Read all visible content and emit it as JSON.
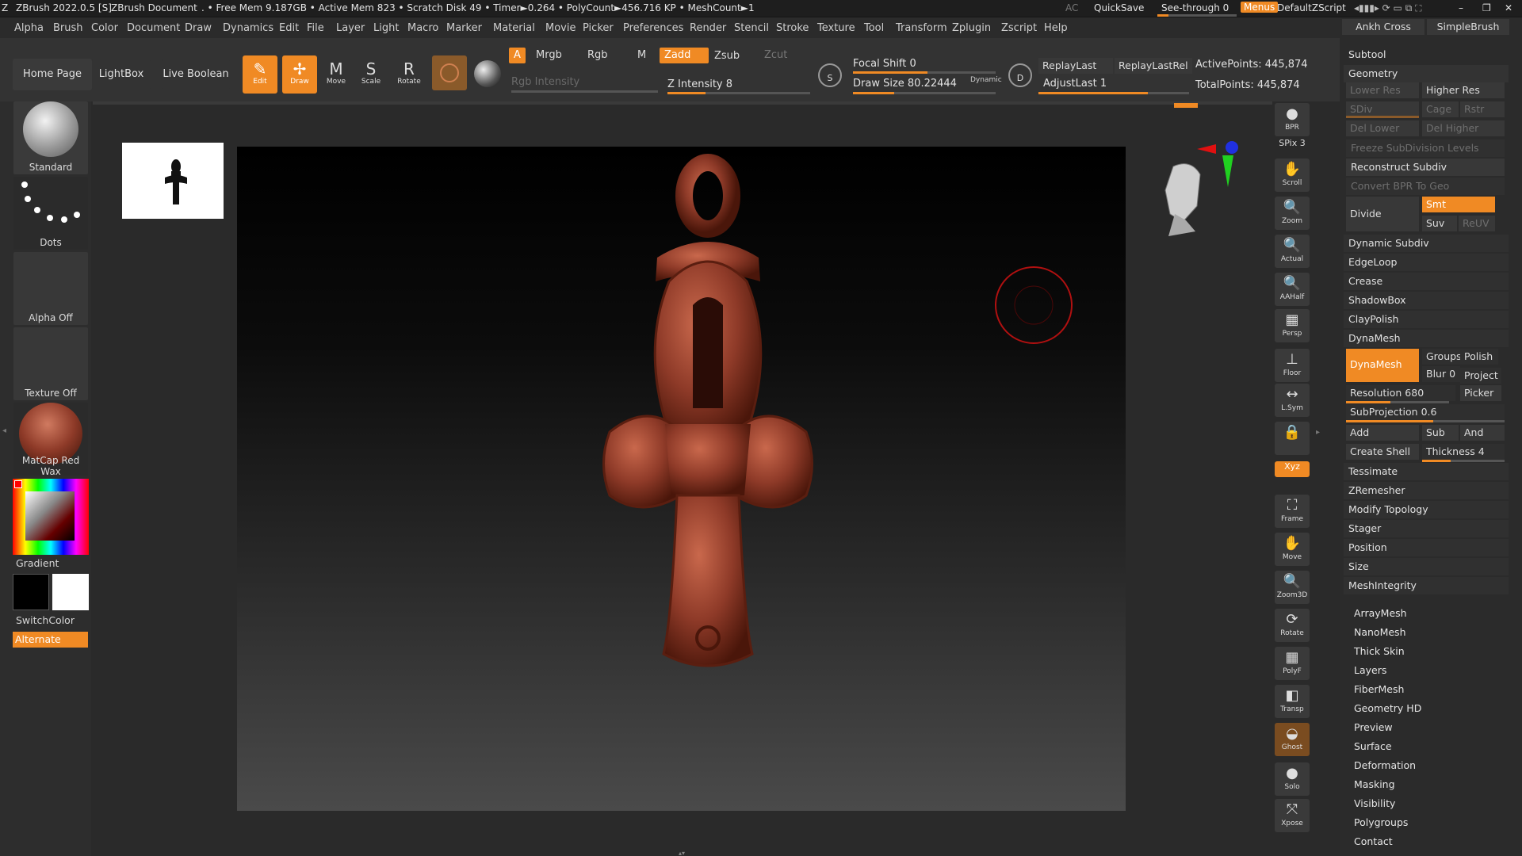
{
  "titlebar": {
    "app": "ZBrush 2022.0.5 [S]",
    "document": "ZBrush Document",
    "stats": ". • Free Mem 9.187GB • Active Mem 823 • Scratch Disk 49 • Timer►0.264 • PolyCount►456.716 KP • MeshCount►1",
    "ac": "AC",
    "quicksave": "QuickSave",
    "seethrough": "See-through  0",
    "menus": "Menus",
    "script": "DefaultZScript"
  },
  "menubar": [
    "Alpha",
    "Brush",
    "Color",
    "Document",
    "Draw",
    "Dynamics",
    "Edit",
    "File",
    "Layer",
    "Light",
    "Macro",
    "Marker",
    "Material",
    "Movie",
    "Picker",
    "Preferences",
    "Render",
    "Stencil",
    "Stroke",
    "Texture",
    "Tool",
    "Transform",
    "Zplugin",
    "Zscript",
    "Help"
  ],
  "toolbar": {
    "home": "Home Page",
    "lightbox": "LightBox",
    "liveboolean": "Live Boolean",
    "tools": [
      {
        "label": "Edit",
        "icon": "✎",
        "on": true
      },
      {
        "label": "Draw",
        "icon": "✢",
        "on": true
      },
      {
        "label": "Move",
        "icon": "M",
        "on": false
      },
      {
        "label": "Scale",
        "icon": "S",
        "on": false
      },
      {
        "label": "Rotate",
        "icon": "R",
        "on": false
      }
    ],
    "a": "A",
    "mrgb": "Mrgb",
    "rgb": "Rgb",
    "m": "M",
    "zadd": "Zadd",
    "zsub": "Zsub",
    "zcut": "Zcut",
    "rgb_intensity": "Rgb Intensity",
    "z_intensity": "Z Intensity 8",
    "focal_shift": "Focal Shift 0",
    "draw_size": "Draw Size 80.22444",
    "dynamic": "Dynamic",
    "replaylast": "ReplayLast",
    "replaylastrel": "ReplayLastRel",
    "adjustlast": "AdjustLast 1",
    "activepoints": "ActivePoints: 445,874",
    "totalpoints": "TotalPoints: 445,874",
    "s_label": "S",
    "d_label": "D"
  },
  "leftshelf": {
    "brush": "Standard",
    "stroke": "Dots",
    "alpha": "Alpha Off",
    "texture": "Texture Off",
    "material": "MatCap Red Wax",
    "gradient": "Gradient",
    "switchcolor": "SwitchColor",
    "alternate": "Alternate"
  },
  "rightshelf": [
    {
      "label": "BPR",
      "icon": "●"
    },
    {
      "label": "SPix 3",
      "icon": ""
    },
    {
      "label": "Scroll",
      "icon": "✋"
    },
    {
      "label": "Zoom",
      "icon": "🔍"
    },
    {
      "label": "Actual",
      "icon": "🔍"
    },
    {
      "label": "AAHalf",
      "icon": "🔍"
    },
    {
      "label": "Persp",
      "icon": "▦"
    },
    {
      "label": "Floor",
      "icon": "⊥"
    },
    {
      "label": "L.Sym",
      "icon": "↔"
    },
    {
      "label": "",
      "icon": "🔒"
    },
    {
      "label": "Xyz",
      "icon": ""
    },
    {
      "label": "Frame",
      "icon": "⛶"
    },
    {
      "label": "Move",
      "icon": "✋"
    },
    {
      "label": "Zoom3D",
      "icon": "🔍"
    },
    {
      "label": "Rotate",
      "icon": "⟳"
    },
    {
      "label": "PolyF",
      "icon": "▦"
    },
    {
      "label": "Transp",
      "icon": "◧"
    },
    {
      "label": "Ghost",
      "icon": "◒"
    },
    {
      "label": "Solo",
      "icon": "●"
    },
    {
      "label": "Xpose",
      "icon": "⤧"
    }
  ],
  "righttray": {
    "brush1": "Ankh Cross",
    "brush2": "SimpleBrush",
    "subtool": "Subtool",
    "geometry": "Geometry",
    "lower_res": "Lower Res",
    "higher_res": "Higher Res",
    "sdiv": "SDiv",
    "cage": "Cage",
    "rstr": "Rstr",
    "del_lower": "Del Lower",
    "del_higher": "Del Higher",
    "freeze": "Freeze SubDivision Levels",
    "reconstruct": "Reconstruct Subdiv",
    "convert_bpr": "Convert BPR To Geo",
    "divide": "Divide",
    "smt": "Smt",
    "suv": "Suv",
    "reuv": "ReUV",
    "dynamic_subdiv": "Dynamic Subdiv",
    "edgeloop": "EdgeLoop",
    "crease": "Crease",
    "shadowbox": "ShadowBox",
    "claypolish": "ClayPolish",
    "dynamesh_header": "DynaMesh",
    "dynamesh_btn": "DynaMesh",
    "groups": "Groups",
    "polish": "Polish",
    "blur": "Blur 0",
    "project": "Project",
    "resolution": "Resolution 680",
    "picker": "Picker",
    "subprojection": "SubProjection 0.6",
    "add": "Add",
    "sub": "Sub",
    "and": "And",
    "create_shell": "Create Shell",
    "thickness": "Thickness 4",
    "tessimate": "Tessimate",
    "zremesher": "ZRemesher",
    "modify_topology": "Modify Topology",
    "stager": "Stager",
    "position": "Position",
    "size": "Size",
    "meshintegrity": "MeshIntegrity",
    "subpalettes": [
      "ArrayMesh",
      "NanoMesh",
      "Thick Skin",
      "Layers",
      "FiberMesh",
      "Geometry HD",
      "Preview",
      "Surface",
      "Deformation",
      "Masking",
      "Visibility",
      "Polygroups",
      "Contact"
    ]
  },
  "colors": {
    "accent": "#f08a24",
    "model": "#8e3a28",
    "bg": "#2b2b2b"
  }
}
